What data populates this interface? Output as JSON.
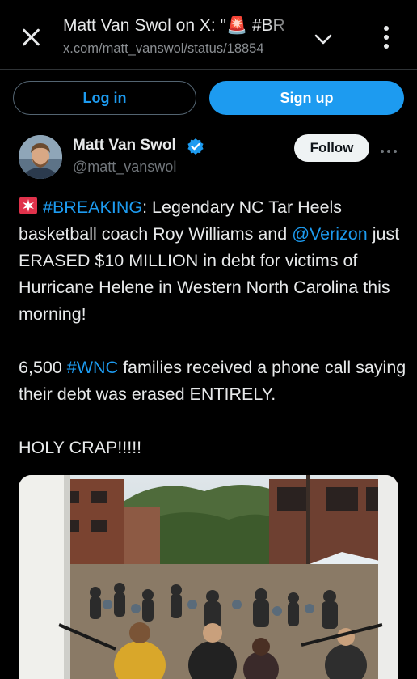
{
  "browser": {
    "title": "Matt Van Swol on X: \"🚨 #BR",
    "url": "x.com/matt_vanswol/status/18854"
  },
  "auth": {
    "login_label": "Log in",
    "signup_label": "Sign up"
  },
  "post": {
    "author_name": "Matt Van Swol",
    "author_handle": "@matt_vanswol",
    "follow_label": "Follow",
    "body": {
      "hashtag_breaking": "#BREAKING",
      "text_1": ": Legendary NC Tar Heels basketball coach Roy Williams and ",
      "mention_verizon": "@Verizon",
      "text_2": " just ERASED $10 MILLION in debt for victims of Hurricane Helene in Western North Carolina this morning!",
      "text_3": "6,500 ",
      "hashtag_wnc": "#WNC",
      "text_4": " families received a phone call saying their debt was erased ENTIRELY.",
      "text_5": "HOLY CRAP!!!!!"
    }
  },
  "icons": {
    "close": "close-icon",
    "chevron": "chevron-down-icon",
    "kebab": "more-vertical-icon",
    "verified": "verified-badge-icon",
    "siren": "siren-emoji-icon",
    "more": "more-horizontal-icon"
  },
  "colors": {
    "background": "#000000",
    "accent": "#1d9bf0",
    "text": "#e7e9ea",
    "muted": "#71767b",
    "follow_bg": "#eff3f4"
  }
}
